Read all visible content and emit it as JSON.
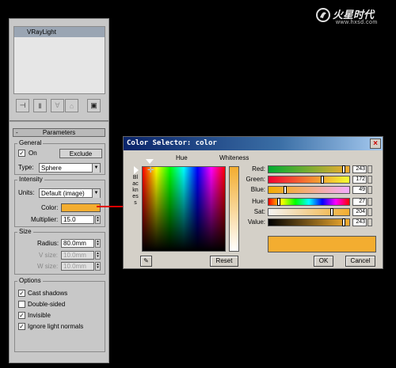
{
  "watermark": {
    "main": "火星时代",
    "sub": "www.hxsd.com"
  },
  "panel": {
    "list_item": "VRayLight",
    "rollout_title": "Parameters",
    "rollout_toggle": "-",
    "general": {
      "label": "General",
      "on_label": "On",
      "on_checked": "✓",
      "exclude_button": "Exclude",
      "type_label": "Type:",
      "type_value": "Sphere"
    },
    "intensity": {
      "label": "Intensity",
      "units_label": "Units:",
      "units_value": "Default (image)",
      "color_label": "Color:",
      "multiplier_label": "Multiplier:",
      "multiplier_value": "15.0"
    },
    "size": {
      "label": "Size",
      "radius_label": "Radius:",
      "radius_value": "80.0mm",
      "vsize_label": "V size:",
      "vsize_value": "10.0mm",
      "wsize_label": "W size:",
      "wsize_value": "10.0mm"
    },
    "options": {
      "label": "Options",
      "items": [
        {
          "label": "Cast shadows",
          "check": "✓"
        },
        {
          "label": "Double-sided",
          "check": ""
        },
        {
          "label": "Invisible",
          "check": "✓"
        },
        {
          "label": "Ignore light normals",
          "check": "✓"
        }
      ]
    }
  },
  "dialog": {
    "title": "Color Selector: color",
    "close": "×",
    "hue_header": "Hue",
    "whiteness_header": "Whiteness",
    "blackness_label": "Blackness",
    "rows": [
      {
        "label": "Red:",
        "value": "243",
        "fraction": 0.95
      },
      {
        "label": "Green:",
        "value": "172",
        "fraction": 0.67
      },
      {
        "label": "Blue:",
        "value": "49",
        "fraction": 0.19
      },
      {
        "label": "Hue:",
        "value": "27",
        "fraction": 0.11
      },
      {
        "label": "Sat:",
        "value": "204",
        "fraction": 0.8
      },
      {
        "label": "Value:",
        "value": "243",
        "fraction": 0.95
      }
    ],
    "reset_button": "Reset",
    "ok_button": "OK",
    "cancel_button": "Cancel"
  },
  "colors": {
    "selected": "#f3ad30",
    "arrow": "#e00000"
  }
}
